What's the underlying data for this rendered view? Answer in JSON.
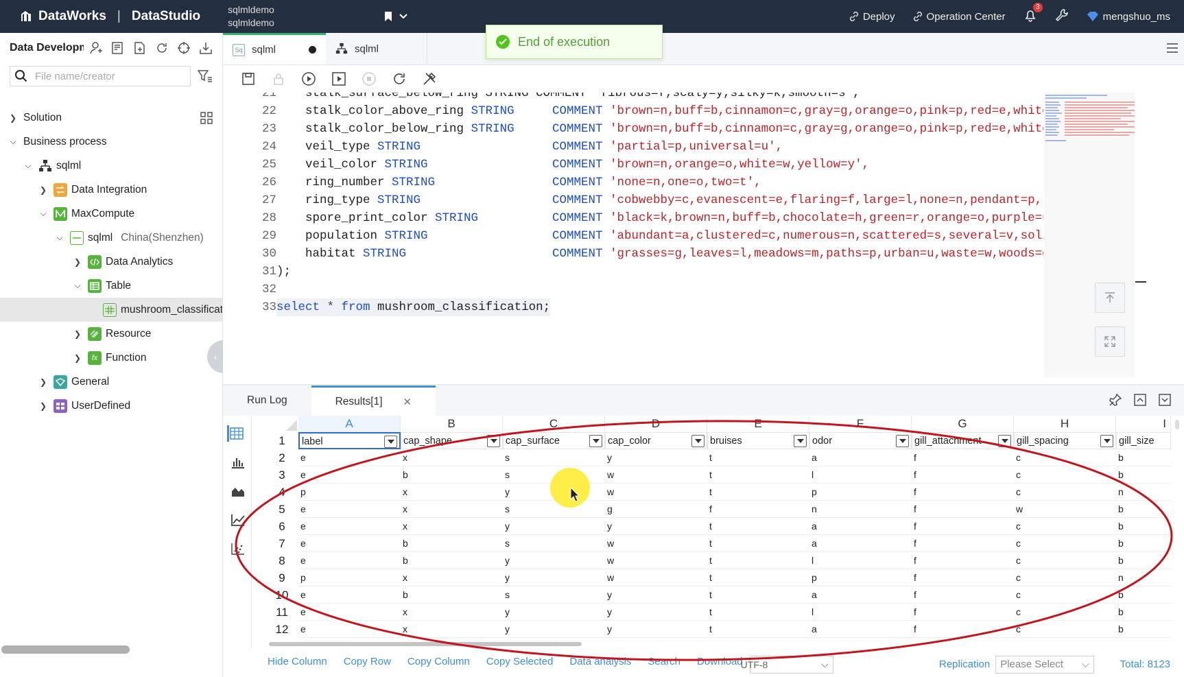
{
  "topbar": {
    "brand": "DataWorks",
    "product": "DataStudio",
    "project_line1": "sqlmldemo",
    "project_line2": "sqlmldemo",
    "deploy": "Deploy",
    "operation_center": "Operation Center",
    "notifications": "3",
    "user": "mengshuo_ms"
  },
  "toast": {
    "message": "End of execution"
  },
  "sidebar": {
    "title": "Data Development",
    "search_placeholder": "File name/creator",
    "items": [
      {
        "label": "Solution"
      },
      {
        "label": "Business process"
      },
      {
        "label": "sqlml"
      },
      {
        "label": "Data Integration"
      },
      {
        "label": "MaxCompute"
      },
      {
        "label": "sqlml",
        "sub": "China(Shenzhen)"
      },
      {
        "label": "Data Analytics"
      },
      {
        "label": "Table"
      },
      {
        "label": "mushroom_classification"
      },
      {
        "label": "Resource"
      },
      {
        "label": "Function"
      },
      {
        "label": "General"
      },
      {
        "label": "UserDefined"
      }
    ]
  },
  "editor_tabs": [
    {
      "label": "sqlml",
      "badge": "Sq"
    },
    {
      "label": "sqlml"
    }
  ],
  "code": {
    "partial_line": {
      "num": "21",
      "text": "stalk_surface_below_ring STRING COMMENT 'fibrous=f,scaly=y,silky=k,smooth=s',"
    },
    "columns": [
      {
        "num": "22",
        "name": "stalk_color_above_ring",
        "type": "STRING",
        "comment": "'brown=n,buff=b,cinnamon=c,gray=g,orange=o,pink=p,red=e,white=w"
      },
      {
        "num": "23",
        "name": "stalk_color_below_ring",
        "type": "STRING",
        "comment": "'brown=n,buff=b,cinnamon=c,gray=g,orange=o,pink=p,red=e,white=w"
      },
      {
        "num": "24",
        "name": "veil_type",
        "type": "STRING",
        "comment": "'partial=p,universal=u',"
      },
      {
        "num": "25",
        "name": "veil_color",
        "type": "STRING",
        "comment": "'brown=n,orange=o,white=w,yellow=y',"
      },
      {
        "num": "26",
        "name": "ring_number",
        "type": "STRING",
        "comment": "'none=n,one=o,two=t',"
      },
      {
        "num": "27",
        "name": "ring_type",
        "type": "STRING",
        "comment": "'cobwebby=c,evanescent=e,flaring=f,large=l,none=n,pendant=p,she"
      },
      {
        "num": "28",
        "name": "spore_print_color",
        "type": "STRING",
        "comment": "'black=k,brown=n,buff=b,chocolate=h,green=r,orange=o,purple=u,w"
      },
      {
        "num": "29",
        "name": "population",
        "type": "STRING",
        "comment": "'abundant=a,clustered=c,numerous=n,scattered=s,several=v,solita"
      },
      {
        "num": "30",
        "name": "habitat",
        "type": "STRING",
        "comment": "'grasses=g,leaves=l,meadows=m,paths=p,urban=u,waste=w,woods=d'"
      }
    ],
    "keyword_comment": "COMMENT",
    "line31": {
      "num": "31",
      "text": ");"
    },
    "line32": {
      "num": "32"
    },
    "line33": {
      "num": "33",
      "kw1": "select",
      "star": " * ",
      "kw2": "from",
      "rest": " mushroom_classification;"
    }
  },
  "results": {
    "tab_runlog": "Run Log",
    "tab_results": "Results[1]",
    "col_letters": [
      "A",
      "B",
      "C",
      "D",
      "E",
      "F",
      "G",
      "H",
      "I"
    ],
    "headers": [
      "label",
      "cap_shape",
      "cap_surface",
      "cap_color",
      "bruises",
      "odor",
      "gill_attachment",
      "gill_spacing",
      "gill_size"
    ],
    "row_numbers": [
      "1",
      "2",
      "3",
      "4",
      "5",
      "6",
      "7",
      "8",
      "9",
      "10",
      "11",
      "12"
    ],
    "rows": [
      [
        "e",
        "x",
        "s",
        "y",
        "t",
        "a",
        "f",
        "c",
        "b"
      ],
      [
        "e",
        "b",
        "s",
        "w",
        "t",
        "l",
        "f",
        "c",
        "b"
      ],
      [
        "p",
        "x",
        "y",
        "w",
        "t",
        "p",
        "f",
        "c",
        "n"
      ],
      [
        "e",
        "x",
        "s",
        "g",
        "f",
        "n",
        "f",
        "w",
        "b"
      ],
      [
        "e",
        "x",
        "y",
        "y",
        "t",
        "a",
        "f",
        "c",
        "b"
      ],
      [
        "e",
        "b",
        "s",
        "w",
        "t",
        "a",
        "f",
        "c",
        "b"
      ],
      [
        "e",
        "b",
        "y",
        "w",
        "t",
        "l",
        "f",
        "c",
        "b"
      ],
      [
        "p",
        "x",
        "y",
        "w",
        "t",
        "p",
        "f",
        "c",
        "n"
      ],
      [
        "e",
        "b",
        "s",
        "y",
        "t",
        "a",
        "f",
        "c",
        "b"
      ],
      [
        "e",
        "x",
        "y",
        "y",
        "t",
        "l",
        "f",
        "c",
        "b"
      ],
      [
        "e",
        "x",
        "y",
        "y",
        "t",
        "a",
        "f",
        "c",
        "b"
      ]
    ]
  },
  "bottombar": {
    "actions": [
      "Hide Column",
      "Copy Row",
      "Copy Column",
      "Copy Selected",
      "Data analysis",
      "Search",
      "Download"
    ],
    "encoding": "UTF-8",
    "replication_label": "Replication",
    "replication_placeholder": "Please Select",
    "total": "Total: 8123"
  },
  "colors": {
    "topbar_bg": "#232f3e",
    "accent_green": "#32b16c",
    "accent_blue": "#3f8fd6",
    "keyword_blue": "#1f4fbf",
    "string_red": "#b8262b",
    "annotation_red": "#c0161c"
  }
}
